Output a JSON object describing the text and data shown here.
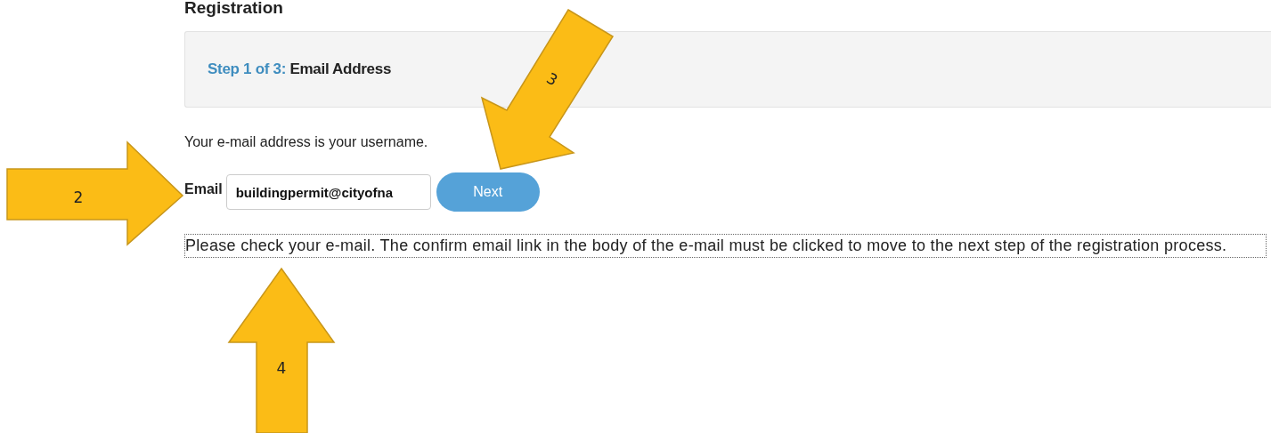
{
  "page_title": "Registration",
  "step": {
    "progress": "Step 1 of 3:",
    "name": "Email Address"
  },
  "intro": "Your e-mail address is your username.",
  "email_field": {
    "label": "Email",
    "value": "buildingpermit@cityofna"
  },
  "next_button": "Next",
  "message": "Please check your e-mail. The confirm email link in the body of the e-mail must be clicked to move to the next step of the registration process.",
  "callouts": [
    {
      "number": "2",
      "kind": "right"
    },
    {
      "number": "3",
      "kind": "diagonal"
    },
    {
      "number": "4",
      "kind": "up"
    }
  ]
}
